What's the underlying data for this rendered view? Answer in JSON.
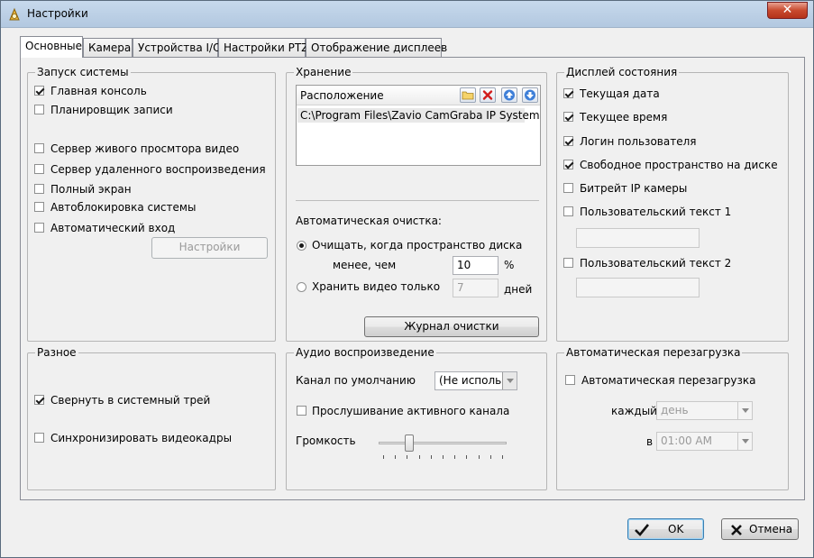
{
  "window": {
    "title": "Настройки",
    "close_glyph": "✕"
  },
  "tabs": [
    {
      "label": "Основные",
      "active": true
    },
    {
      "label": "Камера"
    },
    {
      "label": "Устройства I/O"
    },
    {
      "label": "Настройки PTZ"
    },
    {
      "label": "Отображение дисплеев"
    }
  ],
  "startup": {
    "title": "Запуск системы",
    "items": [
      {
        "label": "Главная консоль",
        "checked": true
      },
      {
        "label": "Планировщик записи",
        "checked": false
      },
      {
        "label": "Сервер живого просмтора видео",
        "checked": false
      },
      {
        "label": "Сервер удаленного воспроизведения",
        "checked": false
      },
      {
        "label": "Полный экран",
        "checked": false
      },
      {
        "label": "Автоблокировка системы",
        "checked": false
      },
      {
        "label": "Автоматический вход",
        "checked": false
      }
    ],
    "settings_button": "Настройки"
  },
  "storage": {
    "title": "Хранение",
    "list_header": "Расположение",
    "paths": [
      "C:\\Program Files\\Zavio CamGraba IP System"
    ],
    "toolbar_icons": [
      "folder-icon",
      "delete-icon",
      "arrow-up-icon",
      "arrow-down-icon"
    ],
    "auto_cleanup_label": "Автоматическая очистка:",
    "option1_label": "Очищать, когда пространство диска",
    "option1_sub_label": "менее, чем",
    "option1_value": "10",
    "option1_unit": "%",
    "option1_selected": true,
    "option2_label": "Хранить видео только",
    "option2_value": "7",
    "option2_unit": "дней",
    "log_button": "Журнал очистки"
  },
  "status_display": {
    "title": "Дисплей состояния",
    "items": [
      {
        "label": "Текущая  дата",
        "checked": true
      },
      {
        "label": "Текущее время",
        "checked": true
      },
      {
        "label": "Логин пользователя",
        "checked": true
      },
      {
        "label": "Свободное пространство на диске",
        "checked": true
      },
      {
        "label": "Битрейт IP камеры",
        "checked": false
      },
      {
        "label": "Пользовательский текст 1",
        "checked": false
      },
      {
        "label": "Пользовательский текст 2",
        "checked": false
      }
    ],
    "custom_text_1": "",
    "custom_text_2": ""
  },
  "misc": {
    "title": "Разное",
    "items": [
      {
        "label": "Свернуть в системный трей",
        "checked": true
      },
      {
        "label": "Синхронизировать видеокадры",
        "checked": false
      }
    ]
  },
  "audio": {
    "title": "Аудио воспроизведение",
    "default_channel_label": "Канал по умолчанию",
    "default_channel_value": "(Не исполь",
    "listen_label": "Прослушивание активного канала",
    "listen_checked": false,
    "volume_label": "Громкость",
    "volume_level": 0.22
  },
  "reboot": {
    "title": "Автоматическая перезагрузка",
    "enable_label": "Автоматическая перезагрузка",
    "enabled": false,
    "every_label": "каждый",
    "every_value": "день",
    "at_label": "в",
    "at_value": "01:00 AM"
  },
  "footer": {
    "ok_label": "OK",
    "cancel_label": "Отмена"
  }
}
